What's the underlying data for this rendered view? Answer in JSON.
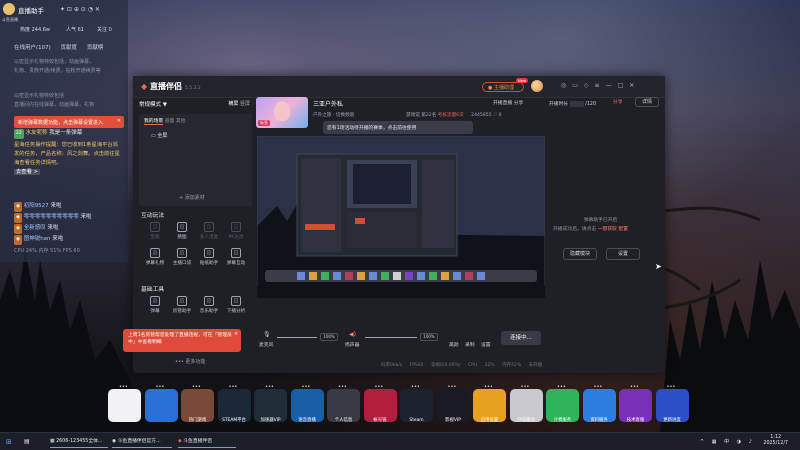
{
  "helper": {
    "title": "直播助手",
    "avatar_label": "斗鱼直播",
    "stats": [
      "热度 244.6w",
      "人气 61",
      "关注 0"
    ],
    "tabs": [
      "在线用户(107)",
      "贡献度",
      "贡献榜"
    ],
    "faded_lines": [
      "以密显示礼物特效包括，动画弹幕，",
      "礼物、贵族开通/续费，钻粉开通续费等",
      "以密显示礼物特效包括",
      "直播间内在线弹幕，动画弹幕，礼物"
    ],
    "notice": "新增弹幕数据功能，点击弹幕设置进入",
    "chat": [
      {
        "badge": "22",
        "name": "水友呢称",
        "text": "我是一条弹幕"
      },
      {
        "badge": "",
        "name": "初阳9527",
        "text": "来啦"
      },
      {
        "badge": "",
        "name": "零零零零零零零零零零",
        "text": "来啦"
      },
      {
        "badge": "",
        "name": "全新感叹",
        "text": "来啦"
      },
      {
        "badge": "",
        "name": "图神锐han",
        "text": "来啦"
      }
    ],
    "task": "星海任务操作提醒：您已收到1条星海平台派发的任务，产品名称：风之剑舞。点击前往星海查看任务详情吧。",
    "task_link": "去查看 >",
    "footer": "CPU 24%  内存 51%  FPS 60"
  },
  "app": {
    "logo": "直播伴侣",
    "version": "5.5.3.2",
    "host_label": "主播助理",
    "new_tag": "New",
    "top_icons": [
      "headset-icon",
      "chat-icon",
      "bell-icon",
      "menu-icon",
      "minimize-icon",
      "maximize-icon",
      "close-icon"
    ],
    "mode": "常规模式 ▼",
    "mode_right": [
      "横屏",
      "竖屏"
    ],
    "scene_tabs": [
      "我的场景",
      "画面",
      "其他"
    ],
    "scene_item": "全屏",
    "add_source": "+ 添加素材",
    "interact_title": "互动玩法",
    "interact_items": [
      {
        "icon": "box-icon",
        "label": "宝箱",
        "dim": true
      },
      {
        "icon": "vote-icon",
        "label": "猜图",
        "dim": false
      },
      {
        "icon": "team-icon",
        "label": "多人连麦",
        "dim": true
      },
      {
        "icon": "pk-icon",
        "label": "PK对战",
        "dim": true
      },
      {
        "icon": "download-icon",
        "label": "弹幕礼物",
        "dim": false
      },
      {
        "icon": "download-icon",
        "label": "主播口袋",
        "dim": false
      },
      {
        "icon": "download-icon",
        "label": "贴纸助手",
        "dim": false
      },
      {
        "icon": "download-icon",
        "label": "弹幕互动",
        "dim": false
      }
    ],
    "tools_title": "基础工具",
    "tools_items": [
      {
        "icon": "doc-icon",
        "label": "弹幕",
        "dim": false
      },
      {
        "icon": "doc-icon",
        "label": "房管助手",
        "dim": false
      },
      {
        "icon": "doc-icon",
        "label": "音乐助手",
        "dim": false
      },
      {
        "icon": "download-icon",
        "label": "下播分析",
        "dim": false
      }
    ],
    "tip": "上周1名房管帮您处理了直播违规，可在「管理员中」中查看明细",
    "more": "••• 更多功能",
    "stream_title": "三亚户外私",
    "category": "户外之旅 · 切换频道",
    "title_tag": "标签",
    "actions": [
      "开播直播",
      "分享",
      "开播设置"
    ],
    "stats_row": [
      "游戏馆",
      "第22名",
      "考核流量6次"
    ],
    "views": "2445855",
    "likes": "0",
    "popover": "您有1场活动待开播的赛季，点击前往使用",
    "popover_hl": "1场活动",
    "live_count": "开播时长",
    "live_count_val": "/120",
    "live_count_btn": "分享",
    "settings_btn": "详情",
    "right_panel": "弹幕助手已开启",
    "right_panel2": "开播成功后，请点击",
    "right_panel_link": "一键获取",
    "right_panel3": "配置",
    "btn_hide": "隐藏模块",
    "btn_set": "设置",
    "mic_label": "麦克风",
    "mic_val": "100%",
    "spk_label": "扬声器",
    "spk_val": "100%",
    "ctrl_icons": [
      "美颜",
      "录制",
      "设置"
    ],
    "live_btn": "连接中...",
    "status": [
      "码率0kb/s",
      "FPS60",
      "丢帧0(0.00%)",
      "CPU 22%",
      "内存42%",
      "未开播"
    ]
  },
  "dock": [
    {
      "label": "",
      "color": "#f2f2f4"
    },
    {
      "label": "",
      "color": "#2a6fd6"
    },
    {
      "label": "热门游戏",
      "color": "#7a4a38"
    },
    {
      "label": "STEAM平台",
      "color": "#1b2838"
    },
    {
      "label": "加速器VIP",
      "color": "#1f2d38"
    },
    {
      "label": "语音直播",
      "color": "#1b5ea8"
    },
    {
      "label": "个人信息",
      "color": "#3a3a44"
    },
    {
      "label": "帐号链",
      "color": "#b21f3e"
    },
    {
      "label": "Steam",
      "color": "#1c2230"
    },
    {
      "label": "影视VIP",
      "color": "#1a1a24"
    },
    {
      "label": "应用设置",
      "color": "#e8a020"
    },
    {
      "label": "外设驱动",
      "color": "#c9c9cf"
    },
    {
      "label": "计费服务",
      "color": "#2fb35a"
    },
    {
      "label": "资料服务",
      "color": "#2d7de0"
    },
    {
      "label": "技术客服",
      "color": "#7a2fb8"
    },
    {
      "label": "更新进度",
      "color": "#2b4fc7"
    }
  ],
  "taskbar": {
    "items": [
      "2606-123455全体...",
      "斗鱼直播伴侣官方...",
      "斗鱼直播伴侣"
    ],
    "time": "1:12",
    "date": "2025/12/7"
  },
  "colors": {
    "accent": "#e36a50",
    "bg": "#1f1f26"
  }
}
